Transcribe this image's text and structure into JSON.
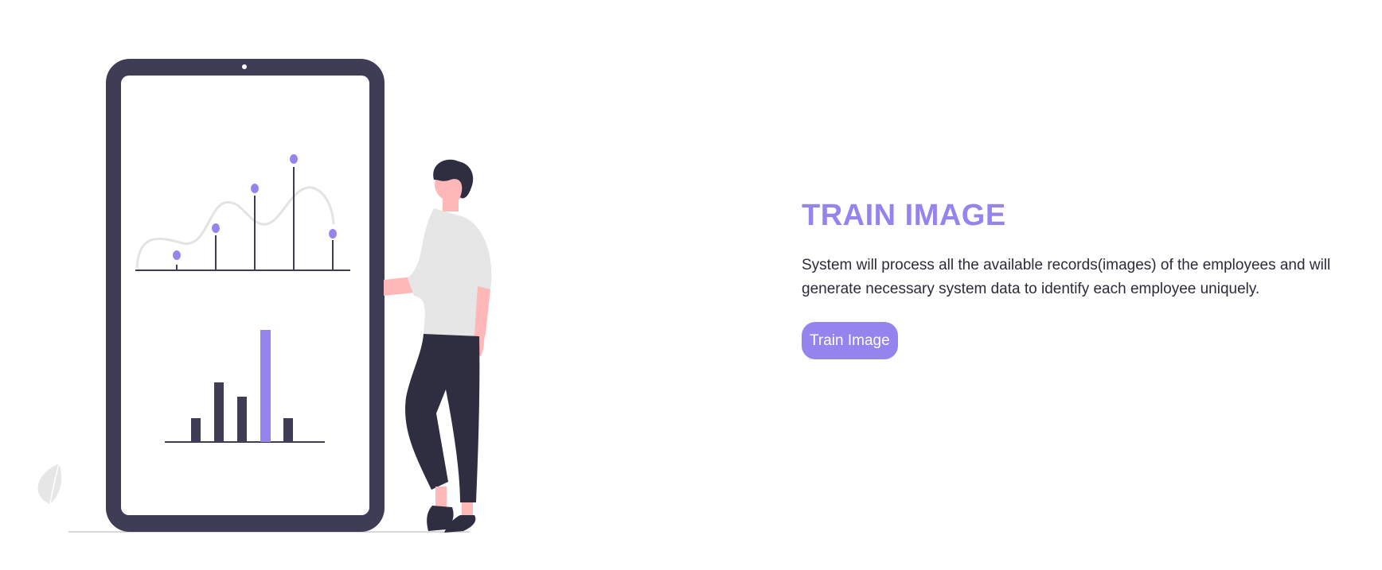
{
  "main": {
    "heading": "TRAIN IMAGE",
    "description": "System will process all the available records(images) of the employees and will generate necessary system data to identify each employee uniquely.",
    "button_label": "Train Image"
  },
  "illustration": {
    "name": "person-with-phone-analytics-illustration"
  },
  "colors": {
    "accent": "#9584ee",
    "device_frame": "#3f3d56",
    "pants": "#2f2e41",
    "shirt": "#e6e6e6",
    "skin": "#ffb8b8",
    "text": "#2b2b3a"
  }
}
